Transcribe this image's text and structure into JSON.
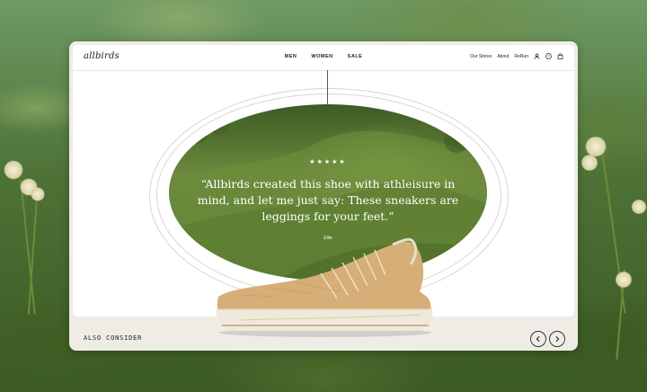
{
  "nav": {
    "logo": "allbirds",
    "center_links": [
      "MEN",
      "WOMEN",
      "SALE"
    ],
    "right_links": [
      "Our Stores",
      "About",
      "ReRun"
    ],
    "icons": [
      "account-icon",
      "help-icon",
      "cart-icon"
    ]
  },
  "hero": {
    "rating_stars": "★★★★★",
    "rating": 5,
    "quote": "“Allbirds created this shoe with athleisure in mind, and let me just say: These sneakers are leggings for your feet.”",
    "author": "Ellie"
  },
  "footer": {
    "also_consider": "ALSO CONSIDER",
    "prev_icon": "chevron-left-icon",
    "next_icon": "chevron-right-icon"
  },
  "colors": {
    "accent": "#222222",
    "shoe_upper": "#d6ae78",
    "shoe_sole": "#efe9dc",
    "panel_bg": "#efece6"
  }
}
